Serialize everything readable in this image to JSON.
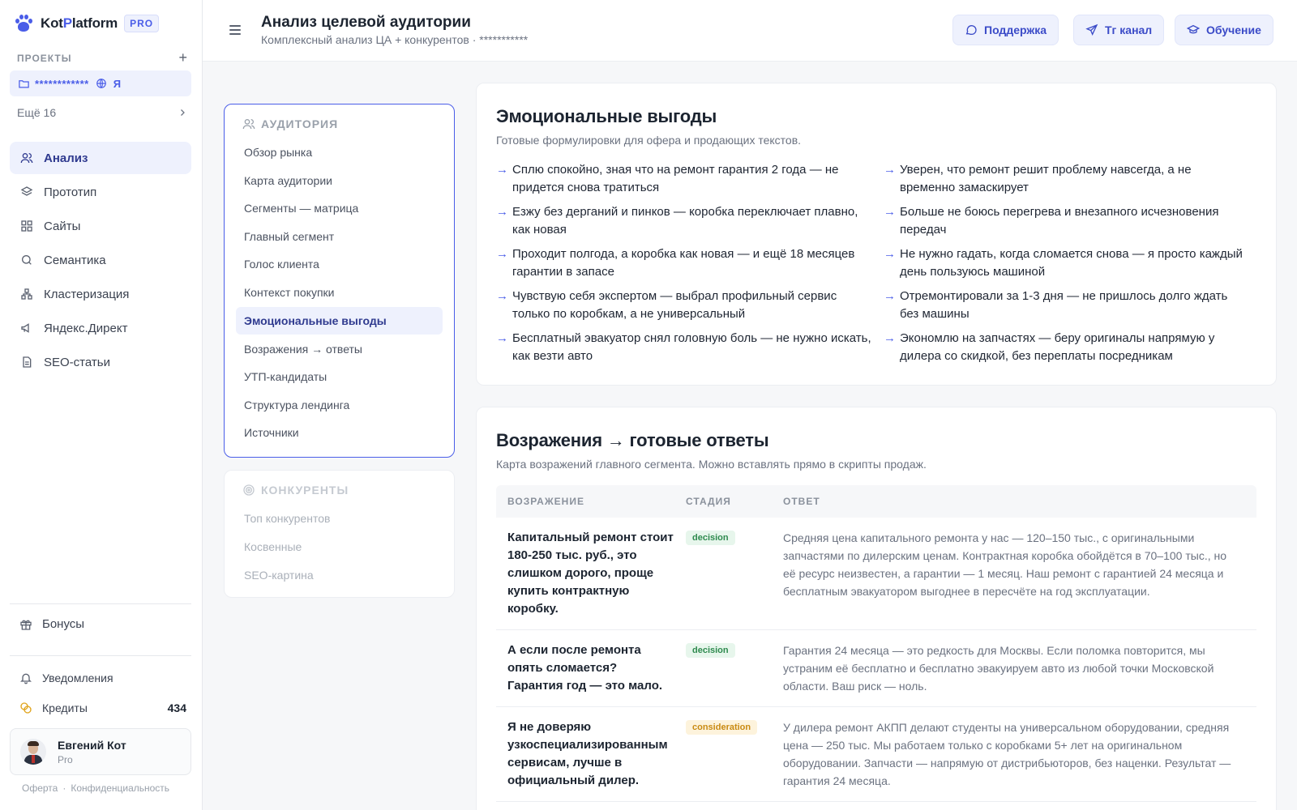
{
  "brand": {
    "name_part1": "Kot",
    "name_accent": "P",
    "name_part2": "latform",
    "badge": "PRO"
  },
  "sidebar": {
    "projects_label": "ПРОЕКТЫ",
    "add_icon": "+",
    "project": {
      "name": "************",
      "globe_icon": "globe-icon",
      "owner": "Я"
    },
    "more": "Ещё 16",
    "items": [
      {
        "label": "Анализ",
        "icon": "users-icon",
        "active": true
      },
      {
        "label": "Прототип",
        "icon": "layers-icon"
      },
      {
        "label": "Сайты",
        "icon": "grid-icon"
      },
      {
        "label": "Семантика",
        "icon": "search-icon"
      },
      {
        "label": "Кластеризация",
        "icon": "cluster-icon"
      },
      {
        "label": "Яндекс.Директ",
        "icon": "megaphone-icon"
      },
      {
        "label": "SEO-статьи",
        "icon": "document-icon"
      }
    ],
    "bonus": "Бонусы",
    "notifications": "Уведомления",
    "credits_label": "Кредиты",
    "credits_value": "434",
    "user": {
      "name": "Евгений Кот",
      "plan": "Pro"
    },
    "footer": {
      "offer": "Оферта",
      "sep": "·",
      "privacy": "Конфиденциальность"
    }
  },
  "header": {
    "title": "Анализ целевой аудитории",
    "subtitle": "Комплексный анализ ЦА + конкурентов · ***********",
    "buttons": [
      {
        "label": "Поддержка",
        "icon": "chat-icon"
      },
      {
        "label": "Тг канал",
        "icon": "telegram-icon"
      },
      {
        "label": "Обучение",
        "icon": "graduation-cap-icon"
      }
    ]
  },
  "toc": {
    "audience_title": "АУДИТОРИЯ",
    "audience_items": [
      "Обзор рынка",
      "Карта аудитории",
      "Сегменты — матрица",
      "Главный сегмент",
      "Голос клиента",
      "Контекст покупки",
      "Эмоциональные выгоды",
      "Возражения → ответы",
      "УТП-кандидаты",
      "Структура лендинга",
      "Источники"
    ],
    "active_index": 6,
    "competitors_title": "КОНКУРЕНТЫ",
    "competitors_items": [
      "Топ конкурентов",
      "Косвенные",
      "SEO-картина"
    ]
  },
  "emotional": {
    "title": "Эмоциональные выгоды",
    "subtitle": "Готовые формулировки для офера и продающих текстов.",
    "arrow": "→",
    "items": [
      "Сплю спокойно, зная что на ремонт гарантия 2 года — не придется снова тратиться",
      "Уверен, что ремонт решит проблему навсегда, а не временно замаскирует",
      "Езжу без дерганий и пинков — коробка переключает плавно, как новая",
      "Больше не боюсь перегрева и внезапного исчезновения передач",
      "Проходит полгода, а коробка как новая — и ещё 18 месяцев гарантии в запасе",
      "Не нужно гадать, когда сломается снова — я просто каждый день пользуюсь машиной",
      "Чувствую себя экспертом — выбрал профильный сервис только по коробкам, а не универсальный",
      "Отремонтировали за 1-3 дня — не пришлось долго ждать без машины",
      "Бесплатный эвакуатор снял головную боль — не нужно искать, как везти авто",
      "Экономлю на запчастях — беру оригиналы напрямую у дилера со скидкой, без переплаты посредникам"
    ]
  },
  "objections": {
    "title": "Возражения → готовые ответы",
    "subtitle": "Карта возражений главного сегмента. Можно вставлять прямо в скрипты продаж.",
    "columns": [
      "ВОЗРАЖЕНИЕ",
      "СТАДИЯ",
      "ОТВЕТ"
    ],
    "rows": [
      {
        "objection": "Капитальный ремонт стоит 180-250 тыс. руб., это слишком дорого, проще купить контрактную коробку.",
        "stage": "decision",
        "answer": "Средняя цена капитального ремонта у нас — 120–150 тыс., с оригинальными запчастями по дилерским ценам. Контрактная коробка обойдётся в 70–100 тыс., но её ресурс неизвестен, а гарантии — 1 месяц. Наш ремонт с гарантией 24 месяца и бесплатным эвакуатором выгоднее в пересчёте на год эксплуатации."
      },
      {
        "objection": "А если после ремонта опять сломается? Гарантия год — это мало.",
        "stage": "decision",
        "answer": "Гарантия 24 месяца — это редкость для Москвы. Если поломка повторится, мы устраним её бесплатно и бесплатно эвакуируем авто из любой точки Московской области. Ваш риск — ноль."
      },
      {
        "objection": "Я не доверяю узкоспециализированным сервисам, лучше в официальный дилер.",
        "stage": "consideration",
        "answer": "У дилера ремонт АКПП делают студенты на универсальном оборудовании, средняя цена — 250 тыс. Мы работаем только с коробками 5+ лет на оригинальном оборудовании. Запчасти — напрямую от дистрибьюторов, без наценки. Результат — гарантия 24 месяца."
      }
    ]
  },
  "colors": {
    "accent": "#4a5de8",
    "decision": "#2e8a4e",
    "consideration": "#c98a12"
  }
}
